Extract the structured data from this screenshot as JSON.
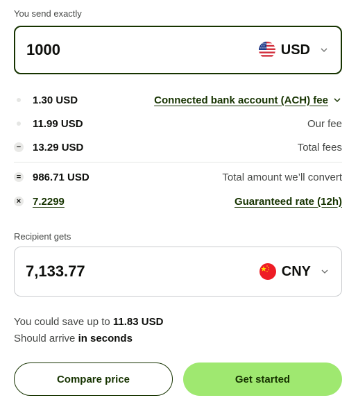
{
  "send": {
    "label": "You send exactly",
    "amount": "1000",
    "currency": "USD",
    "flag_icon": "us-flag-icon"
  },
  "fees": [
    {
      "marker": "dot",
      "amount": "1.30 USD",
      "description": "Connected bank account (ACH) fee",
      "is_dropdown": true
    },
    {
      "marker": "dot",
      "amount": "11.99 USD",
      "description": "Our fee"
    },
    {
      "marker": "minus",
      "marker_symbol": "−",
      "amount": "13.29 USD",
      "description": "Total fees"
    },
    {
      "marker": "equals",
      "marker_symbol": "=",
      "amount": "986.71 USD",
      "description": "Total amount we’ll convert"
    },
    {
      "marker": "times",
      "marker_symbol": "×",
      "amount": "7.2299",
      "description": "Guaranteed rate (12h)",
      "is_link": true
    }
  ],
  "recipient": {
    "label": "Recipient gets",
    "amount": "7,133.77",
    "currency": "CNY",
    "flag_icon": "china-flag-icon"
  },
  "savings": {
    "prefix": "You could save up to ",
    "amount": "11.83 USD"
  },
  "arrival": {
    "prefix": "Should arrive ",
    "time": "in seconds"
  },
  "buttons": {
    "compare": "Compare price",
    "get_started": "Get started"
  },
  "colors": {
    "forest_green": "#163300",
    "bright_green": "#9fe870",
    "china_red": "#ee1c25",
    "text_secondary": "#454745"
  }
}
